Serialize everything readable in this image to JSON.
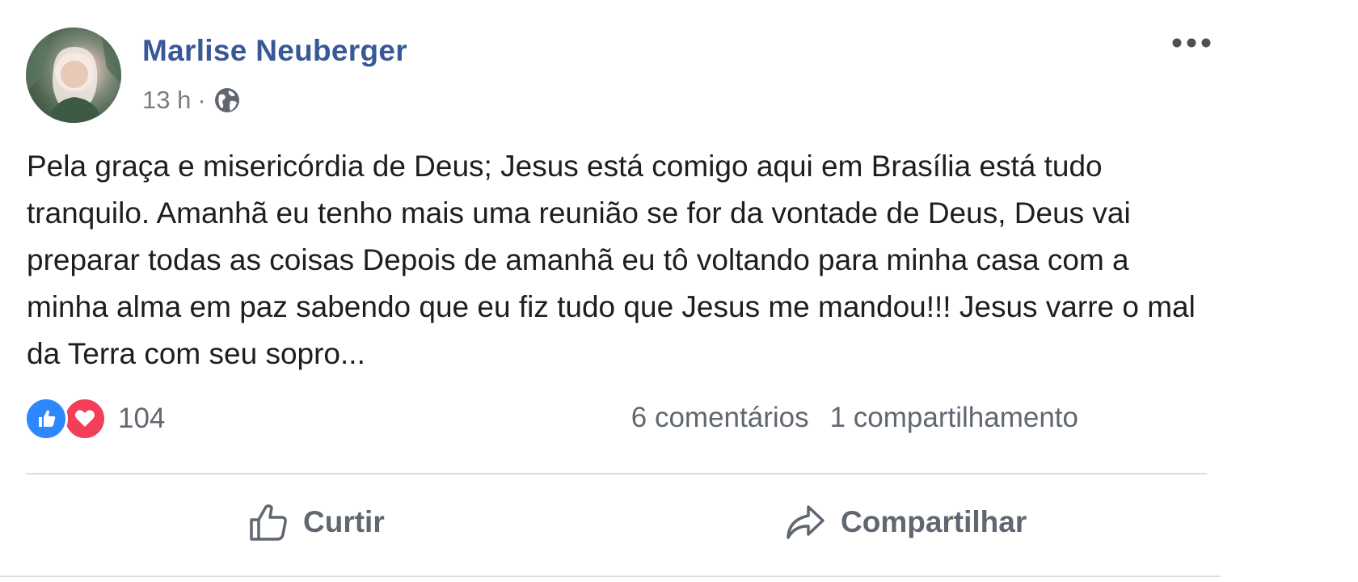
{
  "post": {
    "author": "Marlise Neuberger",
    "time": "13 h",
    "separator": "·",
    "privacy_icon": "globe-icon",
    "more_icon": "more-options-icon",
    "text": "Pela graça e misericórdia de Deus; Jesus está comigo aqui em Brasília está tudo tranquilo. Amanhã eu tenho mais uma reunião se for da vontade de Deus, Deus vai preparar todas as coisas Depois de amanhã eu tô voltando para minha casa com a minha alma em paz sabendo que eu fiz tudo que Jesus me mandou!!! Jesus varre o mal da Terra com seu sopro..."
  },
  "reactions": {
    "icons": [
      "like-reaction-icon",
      "love-reaction-icon"
    ],
    "count": "104"
  },
  "counts": {
    "comments": "6 comentários",
    "shares": "1 compartilhamento"
  },
  "actions": {
    "like_label": "Curtir",
    "share_label": "Compartilhar"
  },
  "colors": {
    "author_link": "#385898",
    "like_blue": "#2d88ff",
    "love_red": "#f33e58",
    "secondary_text": "#606770",
    "body_text": "#1c1e21"
  }
}
